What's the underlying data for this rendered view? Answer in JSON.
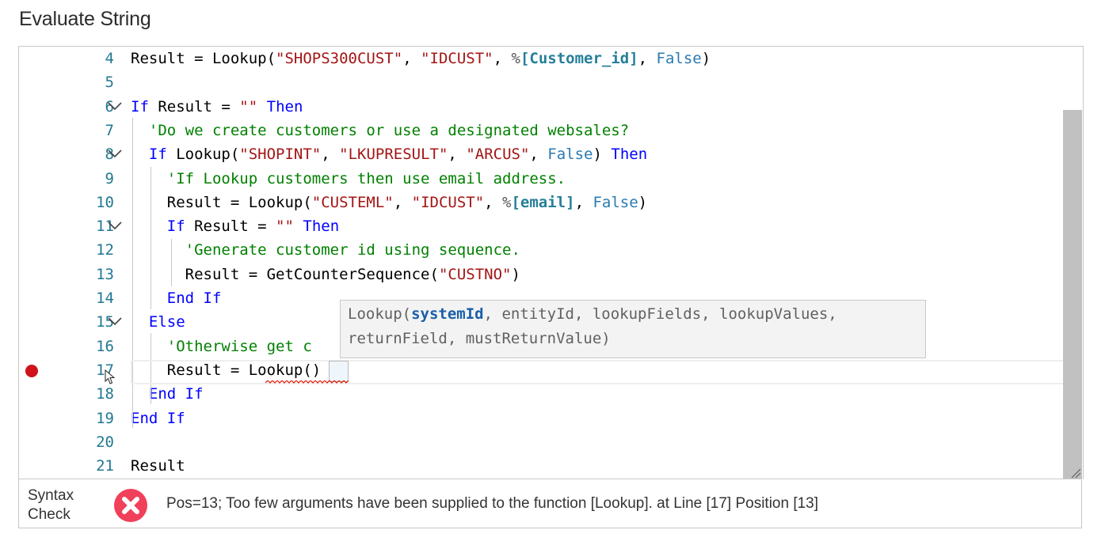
{
  "title": "Evaluate String",
  "editor": {
    "lines": [
      {
        "n": "4",
        "tokens": [
          [
            "fn",
            "Result = Lookup("
          ],
          [
            "str",
            "\"SHOPS300CUST\""
          ],
          [
            "fn",
            ", "
          ],
          [
            "str",
            "\"IDCUST\""
          ],
          [
            "fn",
            ", "
          ],
          [
            "pct",
            "%"
          ],
          [
            "var",
            "[Customer_id]"
          ],
          [
            "fn",
            ", "
          ],
          [
            "bool",
            "False"
          ],
          [
            "fn",
            ")"
          ]
        ]
      },
      {
        "n": "5",
        "tokens": []
      },
      {
        "n": "6",
        "fold": true,
        "tokens": [
          [
            "kw",
            "If"
          ],
          [
            "fn",
            " Result = "
          ],
          [
            "str",
            "\"\""
          ],
          [
            "fn",
            " "
          ],
          [
            "kw",
            "Then"
          ]
        ]
      },
      {
        "n": "7",
        "tokens": [
          [
            "fn",
            "  "
          ],
          [
            "cm",
            "'Do we create customers or use a designated websales?"
          ]
        ]
      },
      {
        "n": "8",
        "fold": true,
        "tokens": [
          [
            "fn",
            "  "
          ],
          [
            "kw",
            "If"
          ],
          [
            "fn",
            " Lookup("
          ],
          [
            "str",
            "\"SHOPINT\""
          ],
          [
            "fn",
            ", "
          ],
          [
            "str",
            "\"LKUPRESULT\""
          ],
          [
            "fn",
            ", "
          ],
          [
            "str",
            "\"ARCUS\""
          ],
          [
            "fn",
            ", "
          ],
          [
            "bool",
            "False"
          ],
          [
            "fn",
            ") "
          ],
          [
            "kw",
            "Then"
          ]
        ]
      },
      {
        "n": "9",
        "tokens": [
          [
            "fn",
            "    "
          ],
          [
            "cm",
            "'If Lookup customers then use email address."
          ]
        ]
      },
      {
        "n": "10",
        "tokens": [
          [
            "fn",
            "    Result = Lookup("
          ],
          [
            "str",
            "\"CUSTEML\""
          ],
          [
            "fn",
            ", "
          ],
          [
            "str",
            "\"IDCUST\""
          ],
          [
            "fn",
            ", "
          ],
          [
            "pct",
            "%"
          ],
          [
            "var",
            "[email]"
          ],
          [
            "fn",
            ", "
          ],
          [
            "bool",
            "False"
          ],
          [
            "fn",
            ")"
          ]
        ]
      },
      {
        "n": "11",
        "fold": true,
        "tokens": [
          [
            "fn",
            "    "
          ],
          [
            "kw",
            "If"
          ],
          [
            "fn",
            " Result = "
          ],
          [
            "str",
            "\"\""
          ],
          [
            "fn",
            " "
          ],
          [
            "kw",
            "Then"
          ]
        ]
      },
      {
        "n": "12",
        "tokens": [
          [
            "fn",
            "      "
          ],
          [
            "cm",
            "'Generate customer id using sequence."
          ]
        ]
      },
      {
        "n": "13",
        "tokens": [
          [
            "fn",
            "      Result = GetCounterSequence("
          ],
          [
            "str",
            "\"CUSTNO\""
          ],
          [
            "fn",
            ")"
          ]
        ]
      },
      {
        "n": "14",
        "tokens": [
          [
            "fn",
            "    "
          ],
          [
            "kw",
            "End If"
          ]
        ]
      },
      {
        "n": "15",
        "fold": true,
        "tokens": [
          [
            "fn",
            "  "
          ],
          [
            "kw",
            "Else"
          ]
        ]
      },
      {
        "n": "16",
        "tokens": [
          [
            "fn",
            "    "
          ],
          [
            "cm",
            "'Otherwise get c"
          ]
        ]
      },
      {
        "n": "17",
        "tokens": [
          [
            "fn",
            "    Result = Lookup()"
          ]
        ]
      },
      {
        "n": "18",
        "tokens": [
          [
            "fn",
            "  "
          ],
          [
            "kw",
            "End If"
          ]
        ]
      },
      {
        "n": "19",
        "tokens": [
          [
            "kw",
            "End If"
          ]
        ]
      },
      {
        "n": "20",
        "tokens": []
      },
      {
        "n": "21",
        "tokens": [
          [
            "fn",
            "Result"
          ]
        ]
      }
    ],
    "breakpoint_line": "17"
  },
  "tooltip": {
    "prefix": "Lookup(",
    "active_param": "systemId",
    "rest_line1": ", entityId, lookupFields, lookupValues,",
    "line2": "returnField, mustReturnValue)"
  },
  "syntax": {
    "label": "Syntax Check",
    "status": "error",
    "icon": "error-x-icon",
    "message": "Pos=13; Too few arguments have been supplied to the function [Lookup]. at Line [17] Position [13]"
  },
  "colors": {
    "keyword": "#0000ff",
    "string": "#a31515",
    "comment": "#008000",
    "boolean": "#2a7ab0",
    "line_number": "#237893",
    "breakpoint": "#d0121b",
    "error_icon": "#f0405a"
  }
}
